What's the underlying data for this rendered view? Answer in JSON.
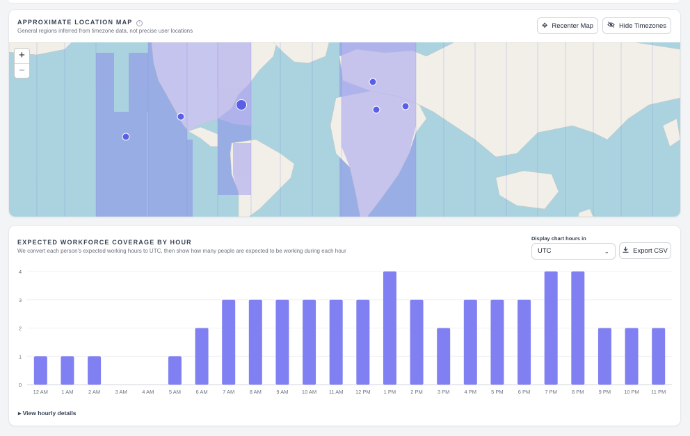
{
  "map_section": {
    "title": "APPROXIMATE LOCATION MAP",
    "subtitle": "General regions inferred from timezone data, not precise user locations",
    "recenter_label": "Recenter Map",
    "hide_tz_label": "Hide Timezones",
    "zoom_in": "+",
    "zoom_out": "−",
    "icons": {
      "recenter": "crosshair-icon",
      "hide": "eye-off-icon",
      "info": "info-icon"
    },
    "colors": {
      "water": "#aad3df",
      "land": "#f2efe9",
      "tz_highlight": "#8b8fe8",
      "marker": "#6366f1"
    }
  },
  "chart_section": {
    "title": "EXPECTED WORKFORCE COVERAGE BY HOUR",
    "subtitle": "We convert each person's expected working hours to UTC, then show how many people are expected to be working during each hour",
    "display_label": "Display chart hours in",
    "timezone_value": "UTC",
    "export_label": "Export CSV",
    "details_label": "▸ View hourly details",
    "bar_color": "#8180f2"
  },
  "chart_data": {
    "type": "bar",
    "title": "EXPECTED WORKFORCE COVERAGE BY HOUR",
    "xlabel": "",
    "ylabel": "",
    "ylim": [
      0,
      4
    ],
    "yticks": [
      "0",
      "1",
      "2",
      "3",
      "4"
    ],
    "grid": true,
    "categories": [
      "12 AM",
      "1 AM",
      "2 AM",
      "3 AM",
      "4 AM",
      "5 AM",
      "6 AM",
      "7 AM",
      "8 AM",
      "9 AM",
      "10 AM",
      "11 AM",
      "12 PM",
      "1 PM",
      "2 PM",
      "3 PM",
      "4 PM",
      "5 PM",
      "6 PM",
      "7 PM",
      "8 PM",
      "9 PM",
      "10 PM",
      "11 PM"
    ],
    "values": [
      1,
      1,
      1,
      0,
      0,
      1,
      2,
      3,
      3,
      3,
      3,
      3,
      3,
      4,
      3,
      2,
      3,
      3,
      3,
      4,
      4,
      2,
      2,
      2
    ]
  }
}
